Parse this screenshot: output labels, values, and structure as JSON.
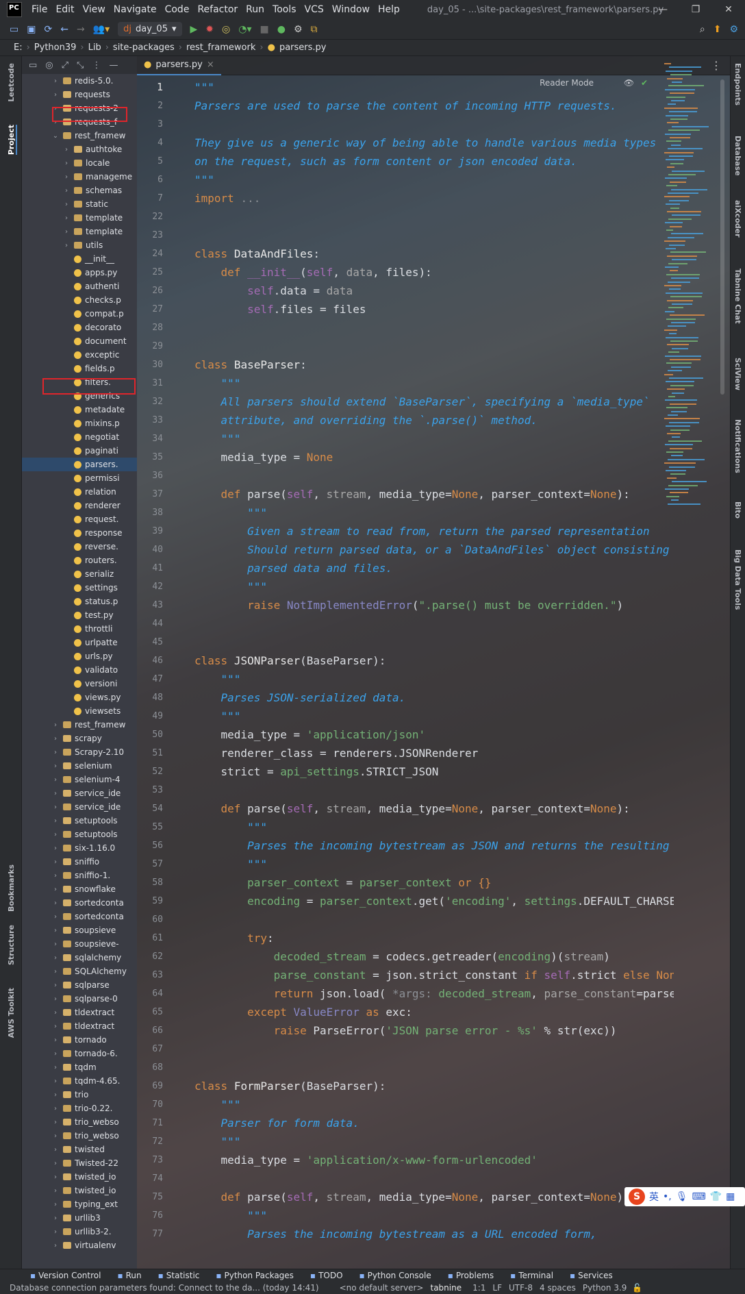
{
  "menubar": {
    "logo": "PC",
    "items": [
      "File",
      "Edit",
      "View",
      "Navigate",
      "Code",
      "Refactor",
      "Run",
      "Tools",
      "VCS",
      "Window",
      "Help"
    ],
    "window_title": "day_05 - ...\\site-packages\\rest_framework\\parsers.py"
  },
  "toolbar": {
    "run_config": "day_05"
  },
  "breadcrumbs": [
    "E:",
    "Python39",
    "Lib",
    "site-packages",
    "rest_framework",
    "parsers.py"
  ],
  "left_tabs": [
    "Leetcode",
    "Project",
    "Bookmarks",
    "Structure",
    "AWS Toolkit"
  ],
  "right_tabs": [
    "Endpoints",
    "Database",
    "aiXcoder",
    "Tabnine Chat",
    "SciView",
    "Notifications",
    "Bito",
    "Big Data Tools"
  ],
  "project_tree": [
    {
      "label": "redis-5.0.",
      "depth": 1,
      "kind": "folder"
    },
    {
      "label": "requests",
      "depth": 1,
      "kind": "pkg"
    },
    {
      "label": "requests-2",
      "depth": 1,
      "kind": "pkg"
    },
    {
      "label": "requests_f",
      "depth": 1,
      "kind": "pkg"
    },
    {
      "label": "rest_framew",
      "depth": 1,
      "kind": "folder",
      "open": true
    },
    {
      "label": "authtoke",
      "depth": 2,
      "kind": "pkg"
    },
    {
      "label": "locale",
      "depth": 2,
      "kind": "folder"
    },
    {
      "label": "manageme",
      "depth": 2,
      "kind": "folder"
    },
    {
      "label": "schemas",
      "depth": 2,
      "kind": "folder"
    },
    {
      "label": "static",
      "depth": 2,
      "kind": "folder"
    },
    {
      "label": "template",
      "depth": 2,
      "kind": "folder"
    },
    {
      "label": "template",
      "depth": 2,
      "kind": "folder"
    },
    {
      "label": "utils",
      "depth": 2,
      "kind": "folder"
    },
    {
      "label": "__init__",
      "depth": 2,
      "kind": "py"
    },
    {
      "label": "apps.py",
      "depth": 2,
      "kind": "py"
    },
    {
      "label": "authenti",
      "depth": 2,
      "kind": "py"
    },
    {
      "label": "checks.p",
      "depth": 2,
      "kind": "py"
    },
    {
      "label": "compat.p",
      "depth": 2,
      "kind": "py"
    },
    {
      "label": "decorato",
      "depth": 2,
      "kind": "py"
    },
    {
      "label": "document",
      "depth": 2,
      "kind": "py"
    },
    {
      "label": "exceptic",
      "depth": 2,
      "kind": "py"
    },
    {
      "label": "fields.p",
      "depth": 2,
      "kind": "py"
    },
    {
      "label": "filters.",
      "depth": 2,
      "kind": "py"
    },
    {
      "label": "generics",
      "depth": 2,
      "kind": "py"
    },
    {
      "label": "metadate",
      "depth": 2,
      "kind": "py"
    },
    {
      "label": "mixins.p",
      "depth": 2,
      "kind": "py"
    },
    {
      "label": "negotiat",
      "depth": 2,
      "kind": "py"
    },
    {
      "label": "paginati",
      "depth": 2,
      "kind": "py"
    },
    {
      "label": "parsers.",
      "depth": 2,
      "kind": "py",
      "selected": true
    },
    {
      "label": "permissi",
      "depth": 2,
      "kind": "py"
    },
    {
      "label": "relation",
      "depth": 2,
      "kind": "py"
    },
    {
      "label": "renderer",
      "depth": 2,
      "kind": "py"
    },
    {
      "label": "request.",
      "depth": 2,
      "kind": "py"
    },
    {
      "label": "response",
      "depth": 2,
      "kind": "py"
    },
    {
      "label": "reverse.",
      "depth": 2,
      "kind": "py"
    },
    {
      "label": "routers.",
      "depth": 2,
      "kind": "py"
    },
    {
      "label": "serializ",
      "depth": 2,
      "kind": "py"
    },
    {
      "label": "settings",
      "depth": 2,
      "kind": "py"
    },
    {
      "label": "status.p",
      "depth": 2,
      "kind": "py"
    },
    {
      "label": "test.py",
      "depth": 2,
      "kind": "py"
    },
    {
      "label": "throttli",
      "depth": 2,
      "kind": "py"
    },
    {
      "label": "urlpatte",
      "depth": 2,
      "kind": "py"
    },
    {
      "label": "urls.py",
      "depth": 2,
      "kind": "py"
    },
    {
      "label": "validato",
      "depth": 2,
      "kind": "py"
    },
    {
      "label": "versioni",
      "depth": 2,
      "kind": "py"
    },
    {
      "label": "views.py",
      "depth": 2,
      "kind": "py"
    },
    {
      "label": "viewsets",
      "depth": 2,
      "kind": "py"
    },
    {
      "label": "rest_framew",
      "depth": 1,
      "kind": "folder"
    },
    {
      "label": "scrapy",
      "depth": 1,
      "kind": "pkg"
    },
    {
      "label": "Scrapy-2.10",
      "depth": 1,
      "kind": "folder"
    },
    {
      "label": "selenium",
      "depth": 1,
      "kind": "pkg"
    },
    {
      "label": "selenium-4",
      "depth": 1,
      "kind": "folder"
    },
    {
      "label": "service_ide",
      "depth": 1,
      "kind": "pkg"
    },
    {
      "label": "service_ide",
      "depth": 1,
      "kind": "folder"
    },
    {
      "label": "setuptools",
      "depth": 1,
      "kind": "pkg"
    },
    {
      "label": "setuptools",
      "depth": 1,
      "kind": "folder"
    },
    {
      "label": "six-1.16.0",
      "depth": 1,
      "kind": "folder"
    },
    {
      "label": "sniffio",
      "depth": 1,
      "kind": "pkg"
    },
    {
      "label": "sniffio-1.",
      "depth": 1,
      "kind": "folder"
    },
    {
      "label": "snowflake",
      "depth": 1,
      "kind": "pkg"
    },
    {
      "label": "sortedconta",
      "depth": 1,
      "kind": "pkg"
    },
    {
      "label": "sortedconta",
      "depth": 1,
      "kind": "folder"
    },
    {
      "label": "soupsieve",
      "depth": 1,
      "kind": "pkg"
    },
    {
      "label": "soupsieve-",
      "depth": 1,
      "kind": "folder"
    },
    {
      "label": "sqlalchemy",
      "depth": 1,
      "kind": "pkg"
    },
    {
      "label": "SQLAlchemy",
      "depth": 1,
      "kind": "folder"
    },
    {
      "label": "sqlparse",
      "depth": 1,
      "kind": "pkg"
    },
    {
      "label": "sqlparse-0",
      "depth": 1,
      "kind": "folder"
    },
    {
      "label": "tldextract",
      "depth": 1,
      "kind": "pkg"
    },
    {
      "label": "tldextract",
      "depth": 1,
      "kind": "folder"
    },
    {
      "label": "tornado",
      "depth": 1,
      "kind": "pkg"
    },
    {
      "label": "tornado-6.",
      "depth": 1,
      "kind": "folder"
    },
    {
      "label": "tqdm",
      "depth": 1,
      "kind": "pkg"
    },
    {
      "label": "tqdm-4.65.",
      "depth": 1,
      "kind": "folder"
    },
    {
      "label": "trio",
      "depth": 1,
      "kind": "pkg"
    },
    {
      "label": "trio-0.22.",
      "depth": 1,
      "kind": "folder"
    },
    {
      "label": "trio_webso",
      "depth": 1,
      "kind": "pkg"
    },
    {
      "label": "trio_webso",
      "depth": 1,
      "kind": "folder"
    },
    {
      "label": "twisted",
      "depth": 1,
      "kind": "pkg"
    },
    {
      "label": "Twisted-22",
      "depth": 1,
      "kind": "folder"
    },
    {
      "label": "twisted_io",
      "depth": 1,
      "kind": "pkg"
    },
    {
      "label": "twisted_io",
      "depth": 1,
      "kind": "folder"
    },
    {
      "label": "typing_ext",
      "depth": 1,
      "kind": "folder"
    },
    {
      "label": "urllib3",
      "depth": 1,
      "kind": "pkg"
    },
    {
      "label": "urllib3-2.",
      "depth": 1,
      "kind": "folder"
    },
    {
      "label": "virtualenv",
      "depth": 1,
      "kind": "pkg"
    }
  ],
  "editor": {
    "tab_label": "parsers.py",
    "reader_mode": "Reader Mode",
    "lines": [
      {
        "n": "1",
        "html": "<span class='doc'>\"\"\"</span>"
      },
      {
        "n": "2",
        "html": "<span class='doc'>Parsers are used to parse the content of incoming HTTP requests.</span>"
      },
      {
        "n": "3",
        "html": ""
      },
      {
        "n": "4",
        "html": "<span class='doc'>They give us a generic way of being able to handle various media types</span>"
      },
      {
        "n": "5",
        "html": "<span class='doc'>on the request, such as form content or json encoded data.</span>"
      },
      {
        "n": "6",
        "html": "<span class='doc'>\"\"\"</span>"
      },
      {
        "n": "7",
        "html": "<span class='kw'>import</span> <span class='fold'>...</span>"
      },
      {
        "n": "22",
        "html": ""
      },
      {
        "n": "23",
        "html": ""
      },
      {
        "n": "24",
        "html": "<span class='kw'>class</span> <span class='cls'>DataAndFiles</span>:"
      },
      {
        "n": "25",
        "html": "    <span class='kw'>def</span> <span class='self'>__init__</span>(<span class='self'>self</span>, <span class='par'>data</span>, files):"
      },
      {
        "n": "26",
        "html": "        <span class='self'>self</span>.data = <span class='par'>data</span>"
      },
      {
        "n": "27",
        "html": "        <span class='self'>self</span>.files = files"
      },
      {
        "n": "28",
        "html": ""
      },
      {
        "n": "29",
        "html": ""
      },
      {
        "n": "30",
        "html": "<span class='kw'>class</span> <span class='cls'>BaseParser</span>:"
      },
      {
        "n": "31",
        "html": "    <span class='doc'>\"\"\"</span>"
      },
      {
        "n": "32",
        "html": "    <span class='doc'>All parsers should extend `BaseParser`, specifying a `media_type`</span>"
      },
      {
        "n": "33",
        "html": "    <span class='doc'>attribute, and overriding the `.parse()` method.</span>"
      },
      {
        "n": "34",
        "html": "    <span class='doc'>\"\"\"</span>"
      },
      {
        "n": "35",
        "html": "    media_type = <span class='kw'>None</span>"
      },
      {
        "n": "36",
        "html": ""
      },
      {
        "n": "37",
        "html": "    <span class='kw'>def</span> parse(<span class='self'>self</span>, <span class='par'>stream</span>, media_type=<span class='kw'>None</span>, parser_context=<span class='kw'>None</span>):"
      },
      {
        "n": "38",
        "html": "        <span class='doc'>\"\"\"</span>"
      },
      {
        "n": "39",
        "html": "        <span class='doc'>Given a stream to read from, return the parsed representation</span>"
      },
      {
        "n": "40",
        "html": "        <span class='doc'>Should return parsed data, or a `DataAndFiles` object consisting</span>"
      },
      {
        "n": "41",
        "html": "        <span class='doc'>parsed data and files.</span>"
      },
      {
        "n": "42",
        "html": "        <span class='doc'>\"\"\"</span>"
      },
      {
        "n": "43",
        "html": "        <span class='kw'>raise</span> <span class='builtin'>NotImplementedError</span>(<span class='str'>\".parse() must be overridden.\"</span>)"
      },
      {
        "n": "44",
        "html": ""
      },
      {
        "n": "45",
        "html": ""
      },
      {
        "n": "46",
        "html": "<span class='kw'>class</span> <span class='cls'>JSONParser</span>(BaseParser):"
      },
      {
        "n": "47",
        "html": "    <span class='doc'>\"\"\"</span>"
      },
      {
        "n": "48",
        "html": "    <span class='doc'>Parses JSON-serialized data.</span>"
      },
      {
        "n": "49",
        "html": "    <span class='doc'>\"\"\"</span>"
      },
      {
        "n": "50",
        "html": "    media_type = <span class='str'>'application/json'</span>"
      },
      {
        "n": "51",
        "html": "    renderer_class = renderers.JSONRenderer"
      },
      {
        "n": "52",
        "html": "    strict = <span class='str'>api_settings</span>.STRICT_JSON"
      },
      {
        "n": "53",
        "html": ""
      },
      {
        "n": "54",
        "html": "    <span class='kw'>def</span> parse(<span class='self'>self</span>, <span class='par'>stream</span>, media_type=<span class='kw'>None</span>, parser_context=<span class='kw'>None</span>):"
      },
      {
        "n": "55",
        "html": "        <span class='doc'>\"\"\"</span>"
      },
      {
        "n": "56",
        "html": "        <span class='doc'>Parses the incoming bytestream as JSON and returns the resulting</span>"
      },
      {
        "n": "57",
        "html": "        <span class='doc'>\"\"\"</span>"
      },
      {
        "n": "58",
        "html": "        <span class='str'>parser_context</span> = <span class='str'>parser_context</span> <span class='kw'>or</span> <span class='kw'>{}</span>"
      },
      {
        "n": "59",
        "html": "        <span class='str'>encoding</span> = <span class='str'>parser_context</span>.get(<span class='str'>'encoding'</span>, <span class='str'>settings</span>.DEFAULT_CHARSET)"
      },
      {
        "n": "60",
        "html": ""
      },
      {
        "n": "61",
        "html": "        <span class='kw'>try</span>:"
      },
      {
        "n": "62",
        "html": "            <span class='str'>decoded_stream</span> = codecs.getreader(<span class='str'>encoding</span>)(<span class='par'>stream</span>)"
      },
      {
        "n": "63",
        "html": "            <span class='str'>parse_constant</span> = json.strict_constant <span class='kw'>if</span> <span class='self'>self</span>.strict <span class='kw'>else</span> <span class='kw'>None</span>"
      },
      {
        "n": "64",
        "html": "            <span class='kw'>return</span> json.load( <span class='fold'>*args:</span> <span class='str'>decoded_stream</span>, <span class='par'>parse_constant</span>=parse_constant)"
      },
      {
        "n": "65",
        "html": "        <span class='kw'>except</span> <span class='builtin'>ValueError</span> <span class='kw'>as</span> exc:"
      },
      {
        "n": "66",
        "html": "            <span class='kw'>raise</span> ParseError(<span class='str'>'JSON parse error - %s'</span> % str(exc))"
      },
      {
        "n": "67",
        "html": ""
      },
      {
        "n": "68",
        "html": ""
      },
      {
        "n": "69",
        "html": "<span class='kw'>class</span> <span class='cls'>FormParser</span>(BaseParser):"
      },
      {
        "n": "70",
        "html": "    <span class='doc'>\"\"\"</span>"
      },
      {
        "n": "71",
        "html": "    <span class='doc'>Parser for form data.</span>"
      },
      {
        "n": "72",
        "html": "    <span class='doc'>\"\"\"</span>"
      },
      {
        "n": "73",
        "html": "    media_type = <span class='str'>'application/x-www-form-urlencoded'</span>"
      },
      {
        "n": "74",
        "html": ""
      },
      {
        "n": "75",
        "html": "    <span class='kw'>def</span> parse(<span class='self'>self</span>, <span class='par'>stream</span>, media_type=<span class='kw'>None</span>, parser_context=<span class='kw'>None</span>):"
      },
      {
        "n": "76",
        "html": "        <span class='doc'>\"\"\"</span>"
      },
      {
        "n": "77",
        "html": "        <span class='doc'>Parses the incoming bytestream as a URL encoded form,</span>"
      }
    ]
  },
  "tool_windows": [
    "Version Control",
    "Run",
    "Statistic",
    "Python Packages",
    "TODO",
    "Python Console",
    "Problems",
    "Terminal",
    "Services"
  ],
  "status": {
    "message": "Database connection parameters found: Connect to the da... (today 14:41)",
    "server": "<no default server>",
    "tabnine": "tabnine",
    "position": "1:1",
    "line_sep": "LF",
    "encoding": "UTF-8",
    "indent": "4 spaces",
    "interpreter": "Python 3.9"
  },
  "ime": {
    "lang": "英"
  }
}
